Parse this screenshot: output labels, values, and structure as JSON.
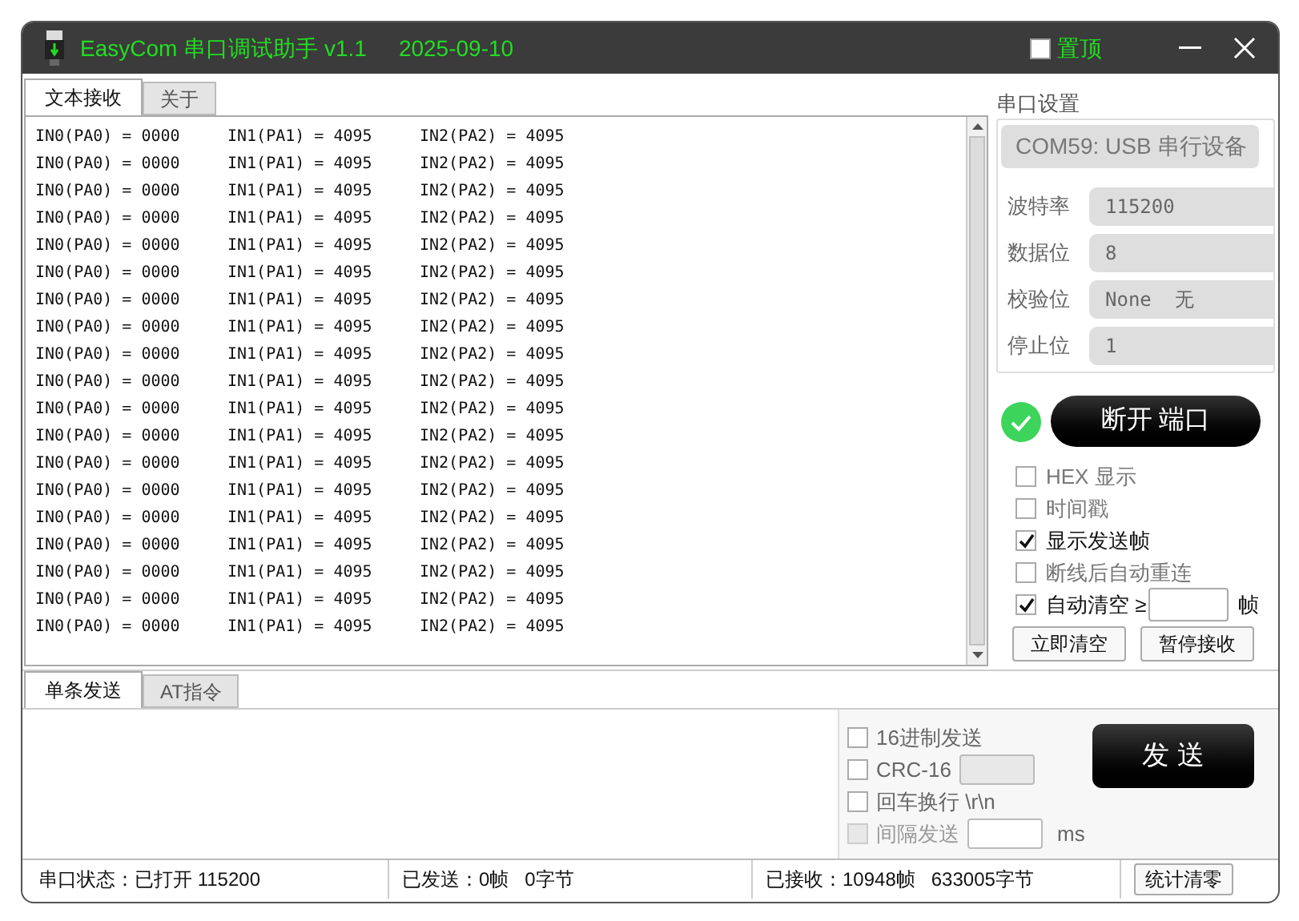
{
  "window": {
    "title": "EasyCom 串口调试助手 v1.1",
    "date": "2025-09-10",
    "pin_on_top": {
      "label": "置顶",
      "checked": false
    }
  },
  "receive_tabs": [
    {
      "label": "文本接收",
      "selected": true
    },
    {
      "label": "关于",
      "selected": false
    }
  ],
  "receive_lines": [
    [
      "IN0(PA0) = 0000",
      "IN1(PA1) = 4095",
      "IN2(PA2) = 4095"
    ],
    [
      "IN0(PA0) = 0000",
      "IN1(PA1) = 4095",
      "IN2(PA2) = 4095"
    ],
    [
      "IN0(PA0) = 0000",
      "IN1(PA1) = 4095",
      "IN2(PA2) = 4095"
    ],
    [
      "IN0(PA0) = 0000",
      "IN1(PA1) = 4095",
      "IN2(PA2) = 4095"
    ],
    [
      "IN0(PA0) = 0000",
      "IN1(PA1) = 4095",
      "IN2(PA2) = 4095"
    ],
    [
      "IN0(PA0) = 0000",
      "IN1(PA1) = 4095",
      "IN2(PA2) = 4095"
    ],
    [
      "IN0(PA0) = 0000",
      "IN1(PA1) = 4095",
      "IN2(PA2) = 4095"
    ],
    [
      "IN0(PA0) = 0000",
      "IN1(PA1) = 4095",
      "IN2(PA2) = 4095"
    ],
    [
      "IN0(PA0) = 0000",
      "IN1(PA1) = 4095",
      "IN2(PA2) = 4095"
    ],
    [
      "IN0(PA0) = 0000",
      "IN1(PA1) = 4095",
      "IN2(PA2) = 4095"
    ],
    [
      "IN0(PA0) = 0000",
      "IN1(PA1) = 4095",
      "IN2(PA2) = 4095"
    ],
    [
      "IN0(PA0) = 0000",
      "IN1(PA1) = 4095",
      "IN2(PA2) = 4095"
    ],
    [
      "IN0(PA0) = 0000",
      "IN1(PA1) = 4095",
      "IN2(PA2) = 4095"
    ],
    [
      "IN0(PA0) = 0000",
      "IN1(PA1) = 4095",
      "IN2(PA2) = 4095"
    ],
    [
      "IN0(PA0) = 0000",
      "IN1(PA1) = 4095",
      "IN2(PA2) = 4095"
    ],
    [
      "IN0(PA0) = 0000",
      "IN1(PA1) = 4095",
      "IN2(PA2) = 4095"
    ],
    [
      "IN0(PA0) = 0000",
      "IN1(PA1) = 4095",
      "IN2(PA2) = 4095"
    ],
    [
      "IN0(PA0) = 0000",
      "IN1(PA1) = 4095",
      "IN2(PA2) = 4095"
    ],
    [
      "IN0(PA0) = 0000",
      "IN1(PA1) = 4095",
      "IN2(PA2) = 4095"
    ]
  ],
  "serial_settings": {
    "title": "串口设置",
    "port": "COM59: USB 串行设备",
    "fields": [
      {
        "label": "波特率",
        "value": "115200"
      },
      {
        "label": "数据位",
        "value": "8"
      },
      {
        "label": "校验位",
        "value": "None  无"
      },
      {
        "label": "停止位",
        "value": "1"
      }
    ],
    "connected": true,
    "connect_button": "断开 端口"
  },
  "receive_options": [
    {
      "label": "HEX 显示",
      "checked": false
    },
    {
      "label": "时间戳",
      "checked": false
    },
    {
      "label": "显示发送帧",
      "checked": true
    },
    {
      "label": "断线后自动重连",
      "checked": false
    },
    {
      "label": "自动清空 ≥",
      "checked": true,
      "unit": "帧"
    }
  ],
  "receive_buttons": [
    "立即清空",
    "暂停接收"
  ],
  "send_tabs": [
    {
      "label": "单条发送",
      "selected": true
    },
    {
      "label": "AT指令",
      "selected": false
    }
  ],
  "send_options": [
    {
      "label": "16进制发送",
      "checked": false,
      "disabled": false
    },
    {
      "label": "CRC-16",
      "checked": false,
      "disabled": false,
      "kind": "field"
    },
    {
      "label": "回车换行 \\r\\n",
      "checked": false,
      "disabled": false
    },
    {
      "label": "间隔发送",
      "checked": false,
      "disabled": true,
      "kind": "field",
      "unit": "ms"
    }
  ],
  "send_button": "发 送",
  "status_bar": {
    "port_status": "串口状态：已打开 115200",
    "sent": "已发送：0帧   0字节",
    "received": "已接收：10948帧   633005字节",
    "reset_button": "统计清零"
  }
}
